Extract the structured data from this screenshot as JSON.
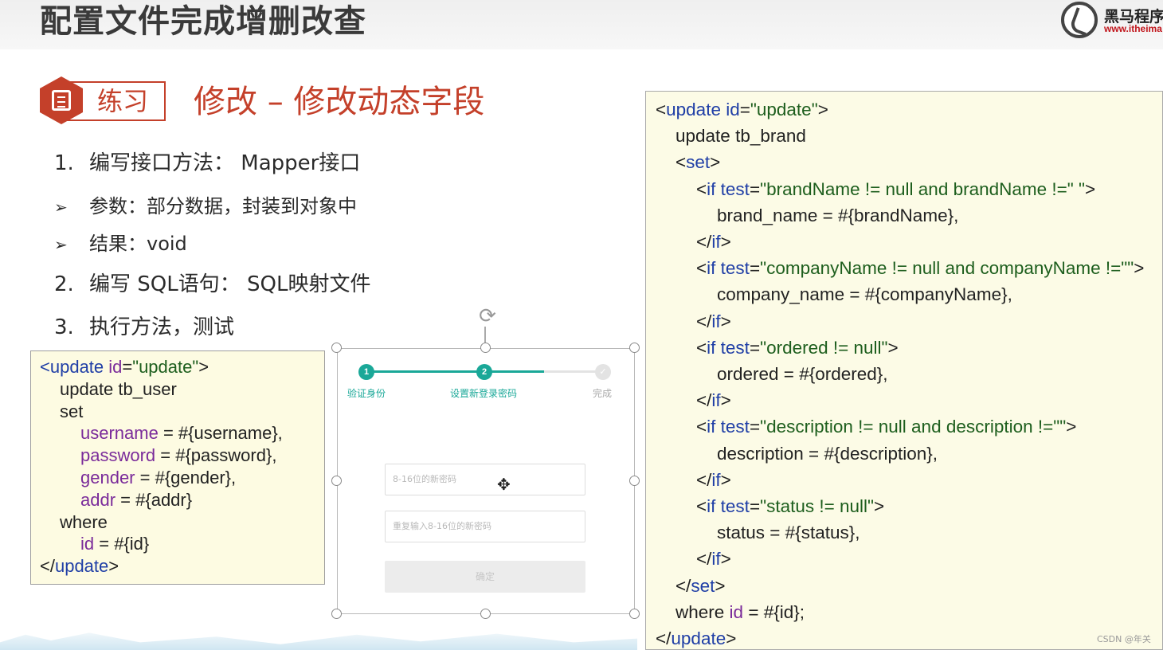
{
  "header": {
    "title": "配置文件完成增删改查",
    "logo_name": "黑马程序",
    "logo_url": "www.itheima"
  },
  "practice": {
    "label": "练习",
    "title": "修改 – 修改动态字段"
  },
  "steps": [
    {
      "num": "1.",
      "text": "编写接口方法：  Mapper接口"
    },
    {
      "num": "➢",
      "text": "参数：部分数据，封装到对象中"
    },
    {
      "num": "➢",
      "text": "结果：void"
    },
    {
      "num": "2.",
      "text": "编写 SQL语句：  SQL映射文件"
    },
    {
      "num": "3.",
      "text": "执行方法，测试"
    }
  ],
  "code_left": {
    "l1_open": "<",
    "l1_tag": "update",
    "l1_attr": " id",
    "l1_eq": "=",
    "l1_val": "\"update\"",
    "l1_close": ">",
    "l2": "update tb_user",
    "l3": "set",
    "fields": [
      {
        "name": "username",
        "rest": " = #{username},"
      },
      {
        "name": "password",
        "rest": " = #{password},"
      },
      {
        "name": "gender",
        "rest": " = #{gender},"
      },
      {
        "name": "addr",
        "rest": " = #{addr}"
      }
    ],
    "where": "where",
    "id_name": "id",
    "id_rest": " = #{id}",
    "end_open": "</",
    "end_tag": "update",
    "end_close": ">"
  },
  "code_right": {
    "update_tag": "update",
    "id_attr": "id",
    "id_val": "\"update\"",
    "table_line": "update tb_brand",
    "set_tag": "set",
    "if_tag": "if",
    "test_attr": "test",
    "conditions": [
      {
        "test": "\"brandName != null and brandName !=\" \"",
        "body": "brand_name = #{brandName},"
      },
      {
        "test": "\"companyName != null and companyName !=\"\"",
        "body": "company_name = #{companyName},"
      },
      {
        "test": "\"ordered != null\"",
        "body": "ordered = #{ordered},"
      },
      {
        "test": "\"description != null and description !=\"\"",
        "body": "description = #{description},"
      },
      {
        "test": "\"status != null\"",
        "body": "status = #{status},"
      }
    ],
    "where_kw": "where ",
    "where_rest": " = #{id};"
  },
  "screenshot": {
    "step1_num": "1",
    "step2_num": "2",
    "step3_num": "✓",
    "step1_label": "验证身份",
    "step2_label": "设置新登录密码",
    "step3_label": "完成",
    "progress": 0.75,
    "input1_placeholder": "8-16位的新密码",
    "input2_placeholder": "重复输入8-16位的新密码",
    "confirm_label": "确定"
  },
  "watermark": "CSDN @年关",
  "colors": {
    "accent": "#c4402a",
    "keyword": "#1f3ea6",
    "attribute": "#7a2b9a",
    "string": "#1d5e1d",
    "progress": "#1aa898"
  }
}
